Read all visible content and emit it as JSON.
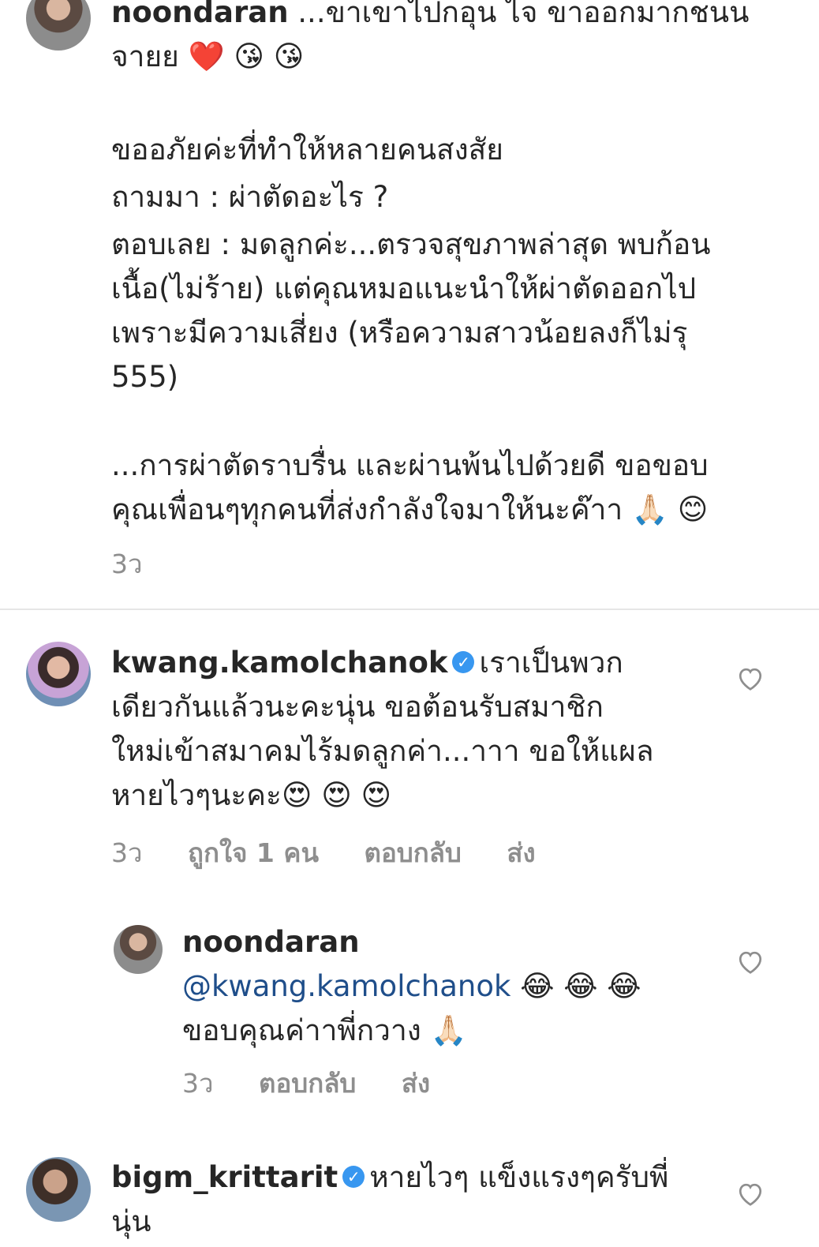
{
  "comment1": {
    "username": "noondaran",
    "lines": [
      "...ขาเขาไปกอุน ไจ ขาออกมากชนน",
      "จายย ❤️ 😘 😘",
      "",
      "ขออภัยค่ะที่ทำให้หลายคนสงสัย",
      "ถามมา : ผ่าตัดอะไร ?",
      "ตอบเลย : มดลูกค่ะ...ตรวจสุขภาพล่าสุด พบก้อน",
      "เนื้อ(ไม่ร้าย) แต่คุณหมอแนะนำให้ผ่าตัดออกไป",
      "เพราะมีความเสี่ยง (หรือความสาวน้อยลงก็ไม่รุ",
      "555)",
      "",
      "...การผ่าตัดราบรื่น และผ่านพ้นไปด้วยดี ขอขอบ",
      "คุณเพื่อนๆทุกคนที่ส่งกำลังใจมาให้นะค๊าา 🙏🏻 😊"
    ],
    "time": "3ว"
  },
  "comment2": {
    "username": "kwang.kamolchanok",
    "text_first": "เราเป็นพวก",
    "lines": [
      "เดียวกันแล้วนะคะนุ่น  ขอต้อนรับสมาชิก",
      "ใหม่เข้าสมาคมไร้มดลูกค่า...าาา ขอให้แผล",
      "หายไวๆนะคะ😍 😍 😍"
    ],
    "time": "3ว",
    "likes": "ถูกใจ 1 คน",
    "reply": "ตอบกลับ",
    "send": "ส่ง"
  },
  "reply1": {
    "username": "noondaran",
    "mention": "@kwang.kamolchanok",
    "mention_emoji": " 😂 😂 😂",
    "line2": "ขอบคุณค่าาพี่กวาง 🙏🏻",
    "time": "3ว",
    "reply": "ตอบกลับ",
    "send": "ส่ง"
  },
  "comment3": {
    "username": "bigm_krittarit",
    "text_first": "หายไวๆ แข็งแรงๆครับพี่",
    "line2": "นุ่น"
  },
  "icons": {
    "verified": "verified-badge-icon",
    "heart": "heart-outline-icon"
  },
  "colors": {
    "verified": "#3897f0",
    "mention": "#1f4e8a",
    "meta": "#8e8e8e"
  }
}
